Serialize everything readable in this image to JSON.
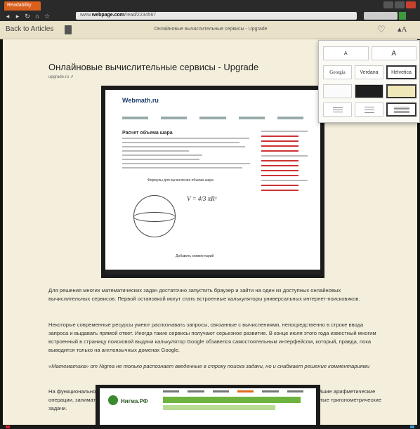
{
  "browser": {
    "tab_label": "Readability",
    "url_prefix": "www.",
    "url_domain": "webpage.com",
    "url_suffix": "/read/2234567",
    "nav_icons": [
      "back-icon",
      "forward-icon",
      "refresh-icon",
      "home-icon",
      "star-icon"
    ]
  },
  "toolbar": {
    "back_label": "Back to Articles",
    "page_title": "Онлайновые вычислительные сервисы - Upgrade",
    "heart_icon": "♡",
    "font_icon": "A"
  },
  "article": {
    "title": "Онлайновые вычислительные сервисы - Upgrade",
    "source": "upgrade.ru",
    "paragraphs": [
      "Для решения многих математических задач достаточно запустить браузер и зайти на один из доступных онлайновых вычислительных сервисов. Первой остановкой могут стать встроенные калькуляторы универсальных интернет-поисковиков.",
      "Некоторые современные ресурсы умеют распознавать запросы, связанные с вычислениями, непосредственно в строке ввода запроса и выдавать прямой ответ. Иногда такие сервисы получают серьезное развитие. В конце июля этого года известный многим встроенный в страницу поисковой выдачи калькулятор Google обзавелся самостоятельным интерфейсом, который, правда, пока выводится только на англоязычных доменах Google.",
      "«Математика» от Nigma не только распознает введенные в строку поиска задачи, но и снабжает решение комментариями",
      "На функциональность калькулятора это дополнение не повлияло. Как и прежде, он умеет выполнять простейшие арифметические операции, заниматься переводом единиц измерения из одной системы в другую, а также обрабатывать простые тригонометрические задачи."
    ]
  },
  "screenshot1": {
    "logo": "Webmath.ru",
    "heading": "Расчет объема шара",
    "subheading": "Формулы для вычисления объема шара",
    "formula": "V = 4/3 πR³",
    "button": "Добавить комментарий"
  },
  "screenshot2": {
    "logo": "Нигма.РФ"
  },
  "popover": {
    "size_small": "A",
    "size_large": "A",
    "fonts": [
      "Georgia",
      "Verdana",
      "Helvetica"
    ],
    "selected_font": "Helvetica",
    "themes": [
      "white",
      "black",
      "sepia"
    ],
    "selected_theme": "sepia",
    "spacings": [
      "narrow",
      "medium",
      "wide"
    ],
    "selected_spacing": "wide"
  }
}
